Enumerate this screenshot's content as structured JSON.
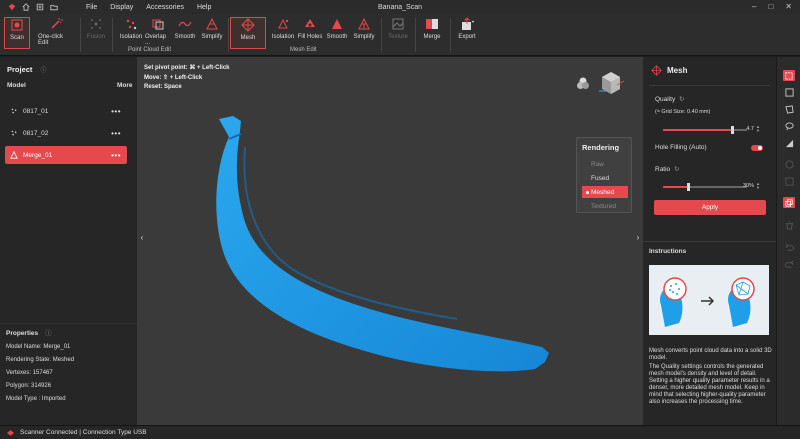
{
  "window": {
    "title": "Banana_Scan",
    "menu": [
      "File",
      "Display",
      "Accessories",
      "Help"
    ]
  },
  "toolbar": {
    "scan": "Scan",
    "one_click_edit": "One-click Edit",
    "fusion": "Fusion",
    "isolation": "Isolation",
    "overlap": "Overlap ...",
    "smooth": "Smooth",
    "simplify": "Simplify",
    "point_cloud_edit_label": "Point Cloud Edit",
    "mesh": "Mesh",
    "mesh_isolation": "Isolation",
    "fill_holes": "Fill Holes",
    "mesh_smooth": "Smooth",
    "mesh_simplify": "Simplify",
    "mesh_edit_label": "Mesh Edit",
    "texture": "Texture",
    "merge": "Merge",
    "export": "Export"
  },
  "left_panel": {
    "project_label": "Project",
    "model_col": "Model",
    "more_col": "More",
    "models": [
      {
        "name": "0817_01",
        "selected": false
      },
      {
        "name": "0817_02",
        "selected": false
      },
      {
        "name": "Merge_01",
        "selected": true
      }
    ],
    "properties_label": "Properties",
    "properties": [
      {
        "key": "Model Name:",
        "value": "Merge_01"
      },
      {
        "key": "Rendering State:",
        "value": "Meshed"
      },
      {
        "key": "Vertexes:",
        "value": "157467"
      },
      {
        "key": "Polygon:",
        "value": "314926"
      },
      {
        "key": "Model Type :",
        "value": "Imported"
      }
    ]
  },
  "viewport": {
    "hints": [
      "Set pivot point: ⌘ + Left-Click",
      "Move: ⇧ + Left-Click",
      "Reset: Space"
    ],
    "rendering": {
      "title": "Rendering",
      "options": [
        "Raw",
        "Fused",
        "Meshed",
        "Textured"
      ],
      "selected": "Meshed"
    },
    "model_color": "#1f9fe8"
  },
  "right_panel": {
    "title": "Mesh",
    "quality_label": "Quality",
    "grid_size": "(≈ Grid Size: 0.40 mm)",
    "quality_value": "4.7",
    "quality_fraction": 0.82,
    "hole_filling_label": "Hole Filling (Auto)",
    "hole_filling_on": true,
    "ratio_label": "Ratio",
    "ratio_value": "30%",
    "ratio_fraction": 0.3,
    "apply_label": "Apply",
    "instructions_label": "Instructions",
    "desc1": "Mesh converts point cloud data into a solid 3D model.",
    "desc2": "The Quality settings controls the generated mesh model's density and level of detail. Setting a higher quality parameter results in a denser, more detailed mesh model. Keep in mind that selecting higher-quality parameter also increases the processing time."
  },
  "status_bar": {
    "text": "Scanner Connected | Connection Type USB"
  },
  "colors": {
    "accent": "#e5484d",
    "banana_blue": "#1f9fe8"
  }
}
